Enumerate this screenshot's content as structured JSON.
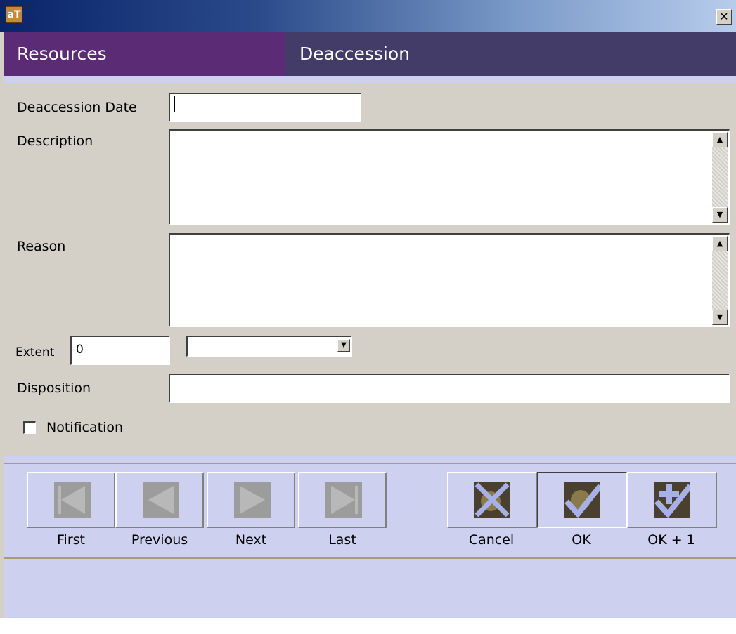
{
  "window": {
    "app_icon_text": "aT",
    "close_glyph": "✕"
  },
  "header": {
    "module": "Resources",
    "title": "Deaccession"
  },
  "form": {
    "deaccession_date_label": "Deaccession Date",
    "deaccession_date_value": "",
    "description_label": "Description",
    "description_value": "",
    "reason_label": "Reason",
    "reason_value": "",
    "extent_label": "Extent",
    "extent_value": "0",
    "extent_type_selected": "",
    "disposition_label": "Disposition",
    "disposition_value": "",
    "notification_label": "Notification",
    "notification_checked": false
  },
  "navigation": {
    "first": "First",
    "previous": "Previous",
    "next": "Next",
    "last": "Last"
  },
  "actions": {
    "cancel": "Cancel",
    "ok": "OK",
    "ok_plus_one": "OK + 1"
  },
  "icons": {
    "first": "first-arrow-icon",
    "previous": "previous-arrow-icon",
    "next": "next-arrow-icon",
    "last": "last-arrow-icon",
    "cancel": "cancel-x-icon",
    "ok": "ok-check-icon",
    "ok_plus_one": "ok-plus-check-icon"
  }
}
